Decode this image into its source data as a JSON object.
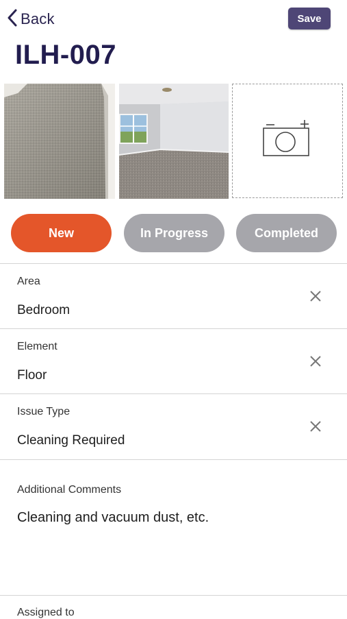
{
  "header": {
    "back_label": "Back",
    "save_label": "Save",
    "title": "ILH-007"
  },
  "photos": {
    "items": [
      "photo-carpet-closeup",
      "photo-empty-room"
    ],
    "add_icon": "camera-add-icon"
  },
  "status": {
    "options": [
      "New",
      "In Progress",
      "Completed"
    ],
    "selected": "New",
    "colors": {
      "selected": "#e4562a",
      "unselected": "#a6a6ab"
    }
  },
  "fields": [
    {
      "label": "Area",
      "value": "Bedroom"
    },
    {
      "label": "Element",
      "value": "Floor"
    },
    {
      "label": "Issue Type",
      "value": "Cleaning Required"
    }
  ],
  "comments": {
    "label": "Additional Comments",
    "value": "Cleaning and vacuum dust, etc."
  },
  "assigned": {
    "label": "Assigned to"
  },
  "colors": {
    "accent": "#4e4676",
    "title": "#221d4f"
  }
}
